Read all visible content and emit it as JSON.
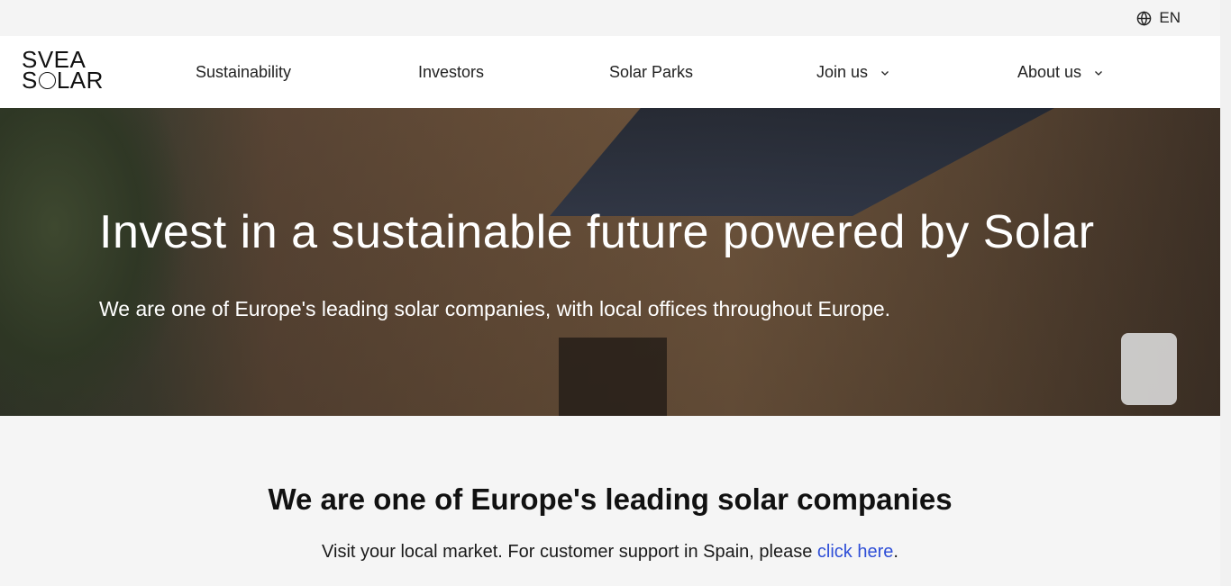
{
  "topbar": {
    "language_label": "EN",
    "language_icon": "globe-icon"
  },
  "logo": {
    "line1": "SVEA",
    "line2_start": "S",
    "line2_end": "LAR"
  },
  "nav": {
    "items": [
      {
        "label": "Sustainability"
      },
      {
        "label": "Investors"
      },
      {
        "label": "Solar Parks"
      },
      {
        "label": "Join us",
        "icon": "chevron-down-icon"
      },
      {
        "label": "About us",
        "icon": "chevron-down-icon"
      }
    ]
  },
  "hero": {
    "title": "Invest in a sustainable future powered by Solar",
    "subtitle": "We are one of Europe's leading solar companies, with local offices throughout Europe."
  },
  "section": {
    "title": "We are one of Europe's leading solar companies",
    "text_before": "Visit your local market. For customer support in Spain, please ",
    "link_text": "click here",
    "text_after": "."
  },
  "colors": {
    "link": "#2f4fd7",
    "background": "#f5f5f5",
    "header": "#ffffff"
  }
}
